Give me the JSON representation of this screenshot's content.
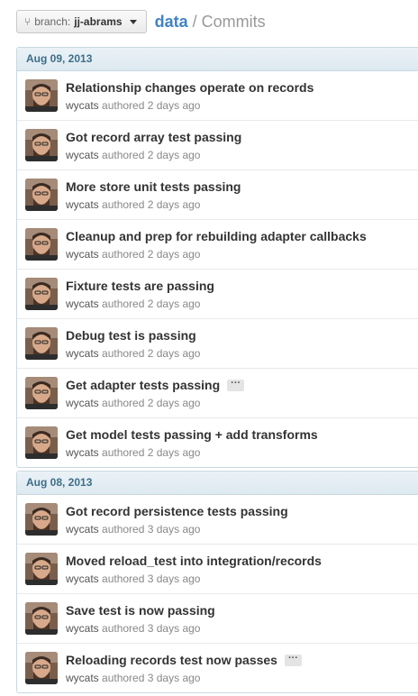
{
  "header": {
    "branch_label": "branch:",
    "branch_name": "jj-abrams",
    "repo": "data",
    "separator": "/",
    "page": "Commits"
  },
  "groups": [
    {
      "date": "Aug 09, 2013",
      "commits": [
        {
          "message": "Relationship changes operate on records",
          "author": "wycats",
          "verb": "authored",
          "time": "2 days ago",
          "ellipsis": false
        },
        {
          "message": "Got record array test passing",
          "author": "wycats",
          "verb": "authored",
          "time": "2 days ago",
          "ellipsis": false
        },
        {
          "message": "More store unit tests passing",
          "author": "wycats",
          "verb": "authored",
          "time": "2 days ago",
          "ellipsis": false
        },
        {
          "message": "Cleanup and prep for rebuilding adapter callbacks",
          "author": "wycats",
          "verb": "authored",
          "time": "2 days ago",
          "ellipsis": false
        },
        {
          "message": "Fixture tests are passing",
          "author": "wycats",
          "verb": "authored",
          "time": "2 days ago",
          "ellipsis": false
        },
        {
          "message": "Debug test is passing",
          "author": "wycats",
          "verb": "authored",
          "time": "2 days ago",
          "ellipsis": false
        },
        {
          "message": "Get adapter tests passing",
          "author": "wycats",
          "verb": "authored",
          "time": "2 days ago",
          "ellipsis": true
        },
        {
          "message": "Get model tests passing + add transforms",
          "author": "wycats",
          "verb": "authored",
          "time": "2 days ago",
          "ellipsis": false
        }
      ]
    },
    {
      "date": "Aug 08, 2013",
      "commits": [
        {
          "message": "Got record persistence tests passing",
          "author": "wycats",
          "verb": "authored",
          "time": "3 days ago",
          "ellipsis": false
        },
        {
          "message": "Moved reload_test into integration/records",
          "author": "wycats",
          "verb": "authored",
          "time": "3 days ago",
          "ellipsis": false
        },
        {
          "message": "Save test is now passing",
          "author": "wycats",
          "verb": "authored",
          "time": "3 days ago",
          "ellipsis": false
        },
        {
          "message": "Reloading records test now passes",
          "author": "wycats",
          "verb": "authored",
          "time": "3 days ago",
          "ellipsis": true
        }
      ]
    }
  ],
  "ellipsis_label": "···"
}
